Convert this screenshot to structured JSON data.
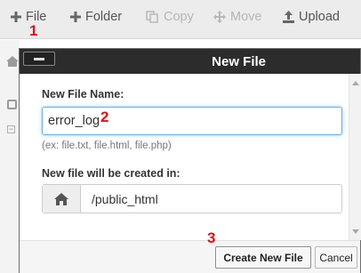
{
  "toolbar": {
    "file_label": "File",
    "folder_label": "Folder",
    "copy_label": "Copy",
    "move_label": "Move",
    "upload_label": "Upload"
  },
  "markers": {
    "m1": "1",
    "m2": "2",
    "m3": "3"
  },
  "dialog": {
    "title": "New File",
    "name_label": "New File Name:",
    "name_value": "error_log",
    "name_hint": "(ex: file.txt, file.html, file.php)",
    "location_label": "New file will be created in:",
    "location_value": "/public_html",
    "create_button": "Create New File",
    "cancel_button": "Cancel"
  },
  "icons": {
    "file": "plus-icon",
    "folder": "plus-icon",
    "copy": "copy-icon",
    "move": "move-arrows-icon",
    "upload": "upload-icon",
    "location": "home-icon",
    "close": "minus-icon"
  },
  "colors": {
    "toolbar_bg": "#ececec",
    "dialog_header_bg": "#2c2c2c",
    "input_focus": "#66afe9",
    "marker_red": "#d9141b",
    "disabled_text": "#b6b6b6"
  }
}
